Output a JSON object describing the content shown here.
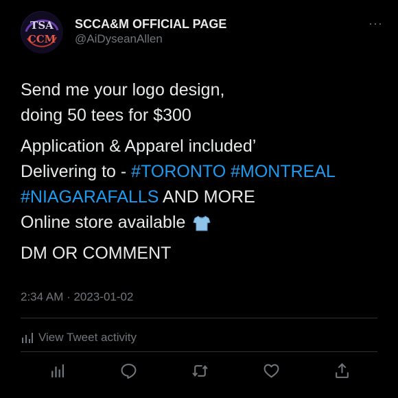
{
  "tweet": {
    "display_name": "SCCA&M OFFICIAL PAGE",
    "handle": "@AiDyseanAllen",
    "more_label": "···",
    "line1": "Send me your logo design,",
    "line2": "doing 50 tees for $300",
    "line3": "Application & Apparel included’",
    "line4_prefix": "Delivering to - ",
    "hashtag_toronto": "#TORONTO",
    "hashtag_montreal": "#MONTREAL",
    "hashtag_niagara": "#NIAGARAFALLS",
    "line5_suffix": " AND MORE",
    "line6": "Online store available",
    "line7": "DM OR COMMENT",
    "timestamp": "2:34 AM · 2023-01-02",
    "activity_label": "View Tweet activity"
  },
  "avatar": {
    "logo_text_top": "TSA",
    "logo_text_bottom": "CCM"
  },
  "icons": {
    "more": "more-icon",
    "shirt": "tshirt-emoji-icon",
    "activity": "analytics-icon",
    "reply": "reply-icon",
    "retweet": "retweet-icon",
    "like": "heart-icon",
    "share": "share-icon"
  },
  "colors": {
    "background": "#000000",
    "text": "#e7e9ea",
    "secondary": "#71767b",
    "link": "#1d9bf0",
    "divider": "#2f3336"
  }
}
